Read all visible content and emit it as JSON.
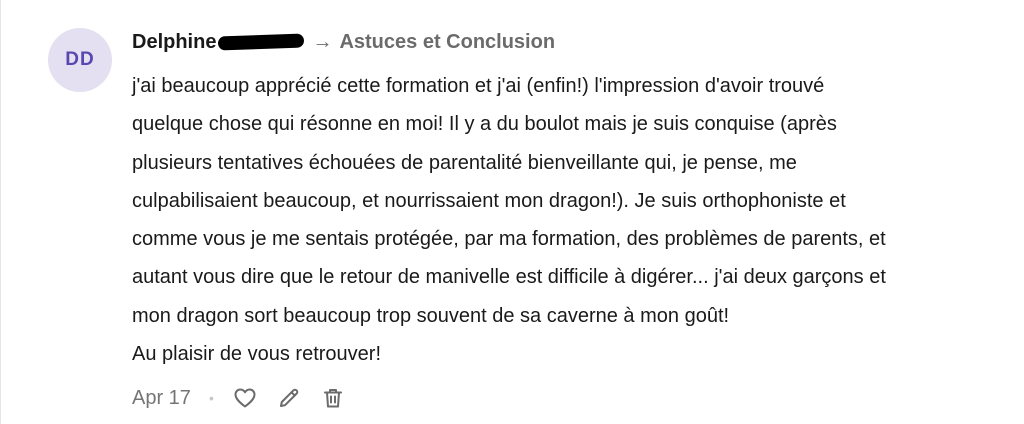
{
  "avatar": {
    "initials": "DD"
  },
  "header": {
    "author": "Delphine",
    "arrow": "→",
    "topic": "Astuces et Conclusion"
  },
  "body": {
    "lines": [
      "j'ai beaucoup apprécié cette formation et j'ai (enfin!) l'impression d'avoir trouvé",
      "quelque chose qui résonne en moi! Il y a du boulot mais je suis conquise (après",
      "plusieurs tentatives échouées de parentalité bienveillante qui, je pense, me",
      "culpabilisaient beaucoup, et nourrissaient mon dragon!). Je suis orthophoniste et",
      "comme vous je me sentais protégée, par ma formation, des problèmes de parents, et",
      "autant vous dire que le retour de manivelle est difficile à digérer... j'ai deux garçons et",
      "mon dragon sort beaucoup trop souvent de sa caverne à mon goût!",
      "Au plaisir de vous retrouver!"
    ]
  },
  "footer": {
    "date": "Apr 17",
    "separator": "•",
    "icons": [
      "heart-icon",
      "pencil-icon",
      "trash-icon"
    ]
  },
  "colors": {
    "avatar_bg": "#e4e0f2",
    "avatar_text": "#5b45b0",
    "muted": "#6b6b6b"
  }
}
